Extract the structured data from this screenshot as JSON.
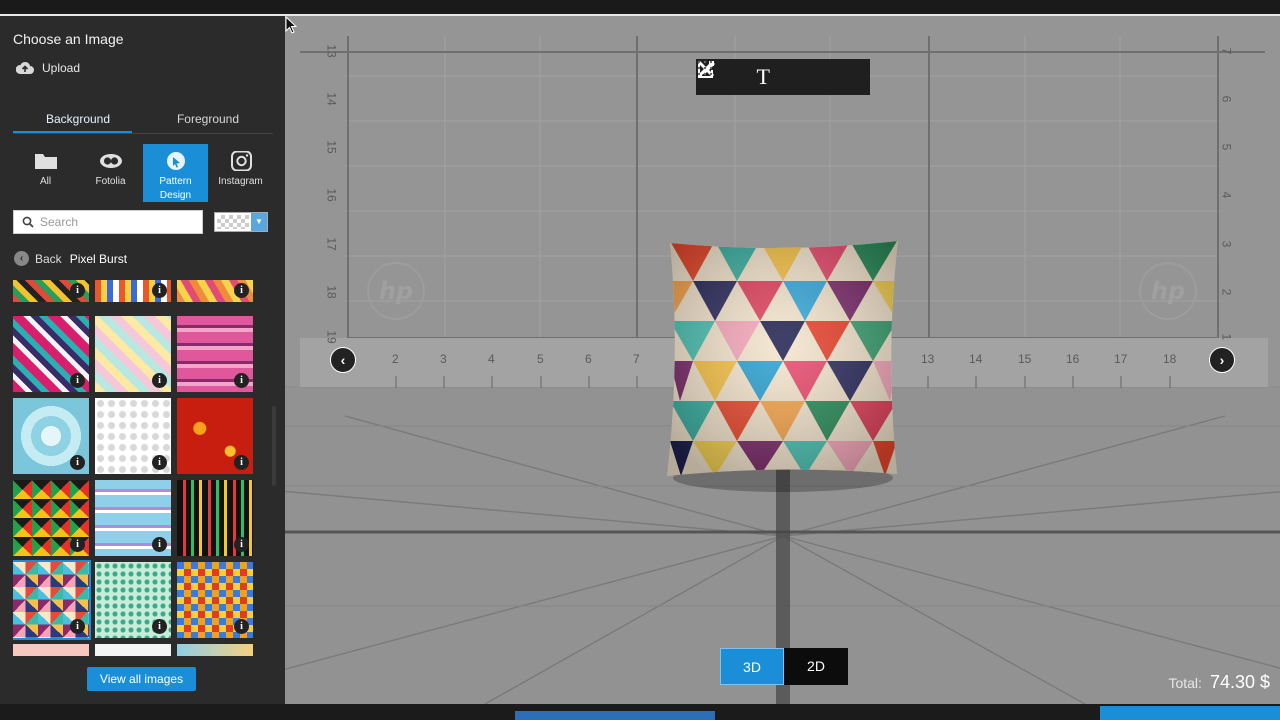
{
  "panel": {
    "title": "Choose an Image",
    "upload_label": "Upload",
    "tabs": [
      {
        "label": "Background",
        "active": true
      },
      {
        "label": "Foreground",
        "active": false
      }
    ],
    "sources": [
      {
        "label": "All",
        "icon": "folder-icon",
        "active": false
      },
      {
        "label": "Fotolia",
        "icon": "fotolia-icon",
        "active": false
      },
      {
        "label": "Pattern Design",
        "icon": "pattern-design-icon",
        "active": true
      },
      {
        "label": "Instagram",
        "icon": "instagram-icon",
        "active": false
      }
    ],
    "search_placeholder": "Search",
    "back_label": "Back",
    "category": "Pixel Burst",
    "view_all_label": "View all images",
    "info_glyph": "i"
  },
  "stage": {
    "toolbar": [
      {
        "name": "tools-icon"
      },
      {
        "name": "text-icon",
        "glyph": "T"
      },
      {
        "name": "edit-image-icon"
      },
      {
        "name": "grid-icon"
      }
    ],
    "ruler_bottom_ticks": [
      "2",
      "3",
      "4",
      "5",
      "6",
      "7",
      "13",
      "14",
      "15",
      "16",
      "17",
      "18"
    ],
    "ruler_left_ticks": [
      "13",
      "14",
      "15",
      "16",
      "17",
      "18",
      "19"
    ],
    "ruler_right_ticks": [
      "7",
      "6",
      "5",
      "4",
      "3",
      "2",
      "1"
    ],
    "watermark": "hp",
    "modes": [
      {
        "label": "3D",
        "active": true
      },
      {
        "label": "2D",
        "active": false
      }
    ],
    "total_label": "Total:",
    "total_value": "74.30 $"
  },
  "colors": {
    "accent": "#1a8fd8",
    "panel_bg": "#2b2b2b",
    "stage_bg": "#8f8f8f"
  }
}
